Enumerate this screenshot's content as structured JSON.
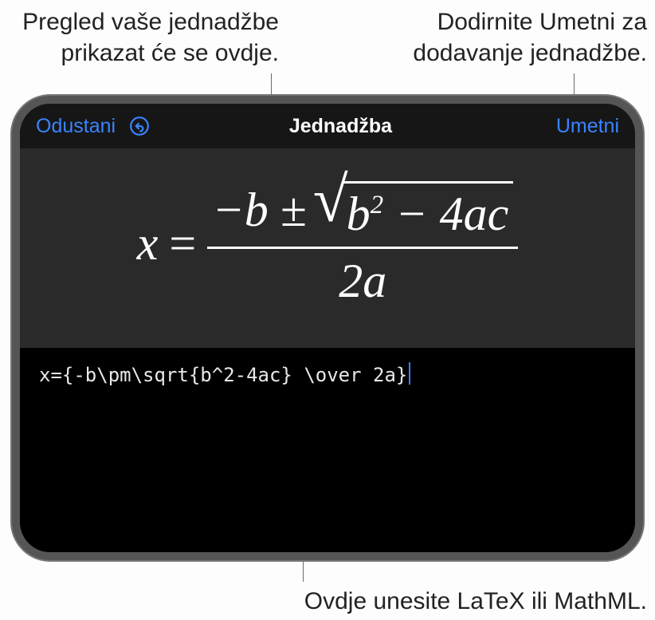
{
  "callouts": {
    "preview": "Pregled vaše jednadžbe prikazat će se ovdje.",
    "insert": "Dodirnite Umetni za dodavanje jednadžbe.",
    "input": "Ovdje unesite LaTeX ili MathML."
  },
  "dialog": {
    "cancel_label": "Odustani",
    "title": "Jednadžba",
    "insert_label": "Umetni"
  },
  "equation": {
    "lhs": "x",
    "eq": "=",
    "num_pre": "−b ±",
    "rad_inner": "b<sup>2</sup> − 4ac",
    "den": "2a"
  },
  "input": {
    "value": "x={-b\\pm\\sqrt{b^2-4ac} \\over 2a}"
  },
  "icons": {
    "undo": "undo-icon"
  },
  "accent_color": "#3a84ff"
}
